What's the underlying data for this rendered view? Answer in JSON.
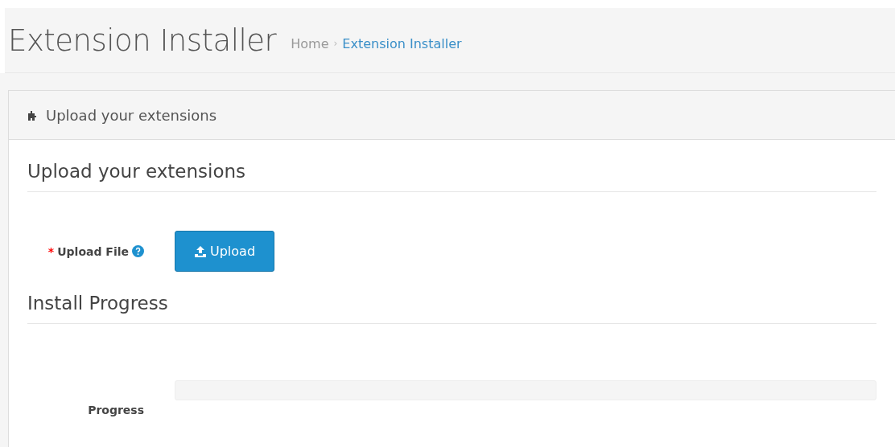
{
  "header": {
    "title": "Extension Installer",
    "separator": "›",
    "breadcrumb": [
      {
        "label": "Home",
        "selected": false
      },
      {
        "label": "Extension Installer",
        "selected": true
      }
    ]
  },
  "panel": {
    "heading": "Upload your extensions",
    "sections": [
      {
        "title": "Upload your extensions",
        "fields": [
          {
            "kind": "upload",
            "required_mark": "*",
            "label": "Upload File",
            "button": "Upload"
          }
        ]
      },
      {
        "title": "Install Progress",
        "fields": [
          {
            "kind": "progress",
            "label": "Progress",
            "level": 0
          }
        ]
      }
    ]
  }
}
